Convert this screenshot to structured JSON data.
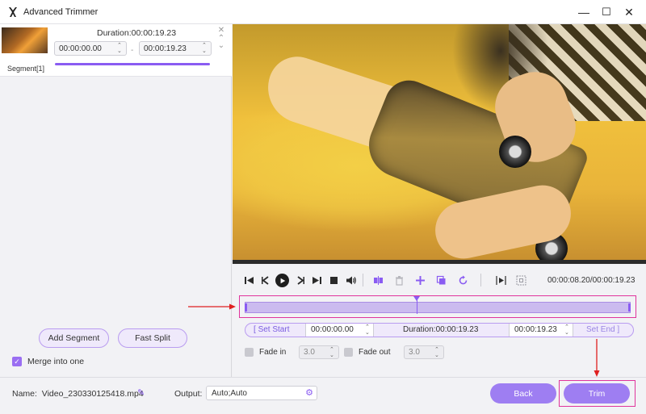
{
  "window": {
    "title": "Advanced Trimmer",
    "controls": {
      "minimize": "—",
      "maximize": "☐",
      "close": "✕"
    }
  },
  "segment": {
    "label": "Segment[1]",
    "duration": "Duration:00:00:19.23",
    "start": "00:00:00.00",
    "end": "00:00:19.23",
    "separator": "-"
  },
  "left_panel": {
    "add_segment": "Add Segment",
    "fast_split": "Fast Split",
    "merge_label": "Merge into one",
    "merge_checked": true
  },
  "player": {
    "time_readout": "00:00:08.20/00:00:19.23",
    "progress": 0.43
  },
  "set_bar": {
    "set_start": "Set Start",
    "start_time": "00:00:00.00",
    "duration": "Duration:00:00:19.23",
    "end_time": "00:00:19.23",
    "set_end": "Set End"
  },
  "fade": {
    "fade_in_label": "Fade in",
    "fade_in_value": "3.0",
    "fade_out_label": "Fade out",
    "fade_out_value": "3.0"
  },
  "footer": {
    "name_label": "Name:",
    "file_name": "Video_230330125418.mp4",
    "output_label": "Output:",
    "output_value": "Auto;Auto",
    "back": "Back",
    "trim": "Trim"
  },
  "colors": {
    "accent": "#8a5cf2",
    "button": "#9e7ef2",
    "highlight": "#e0349c",
    "arrow": "#e02020"
  }
}
